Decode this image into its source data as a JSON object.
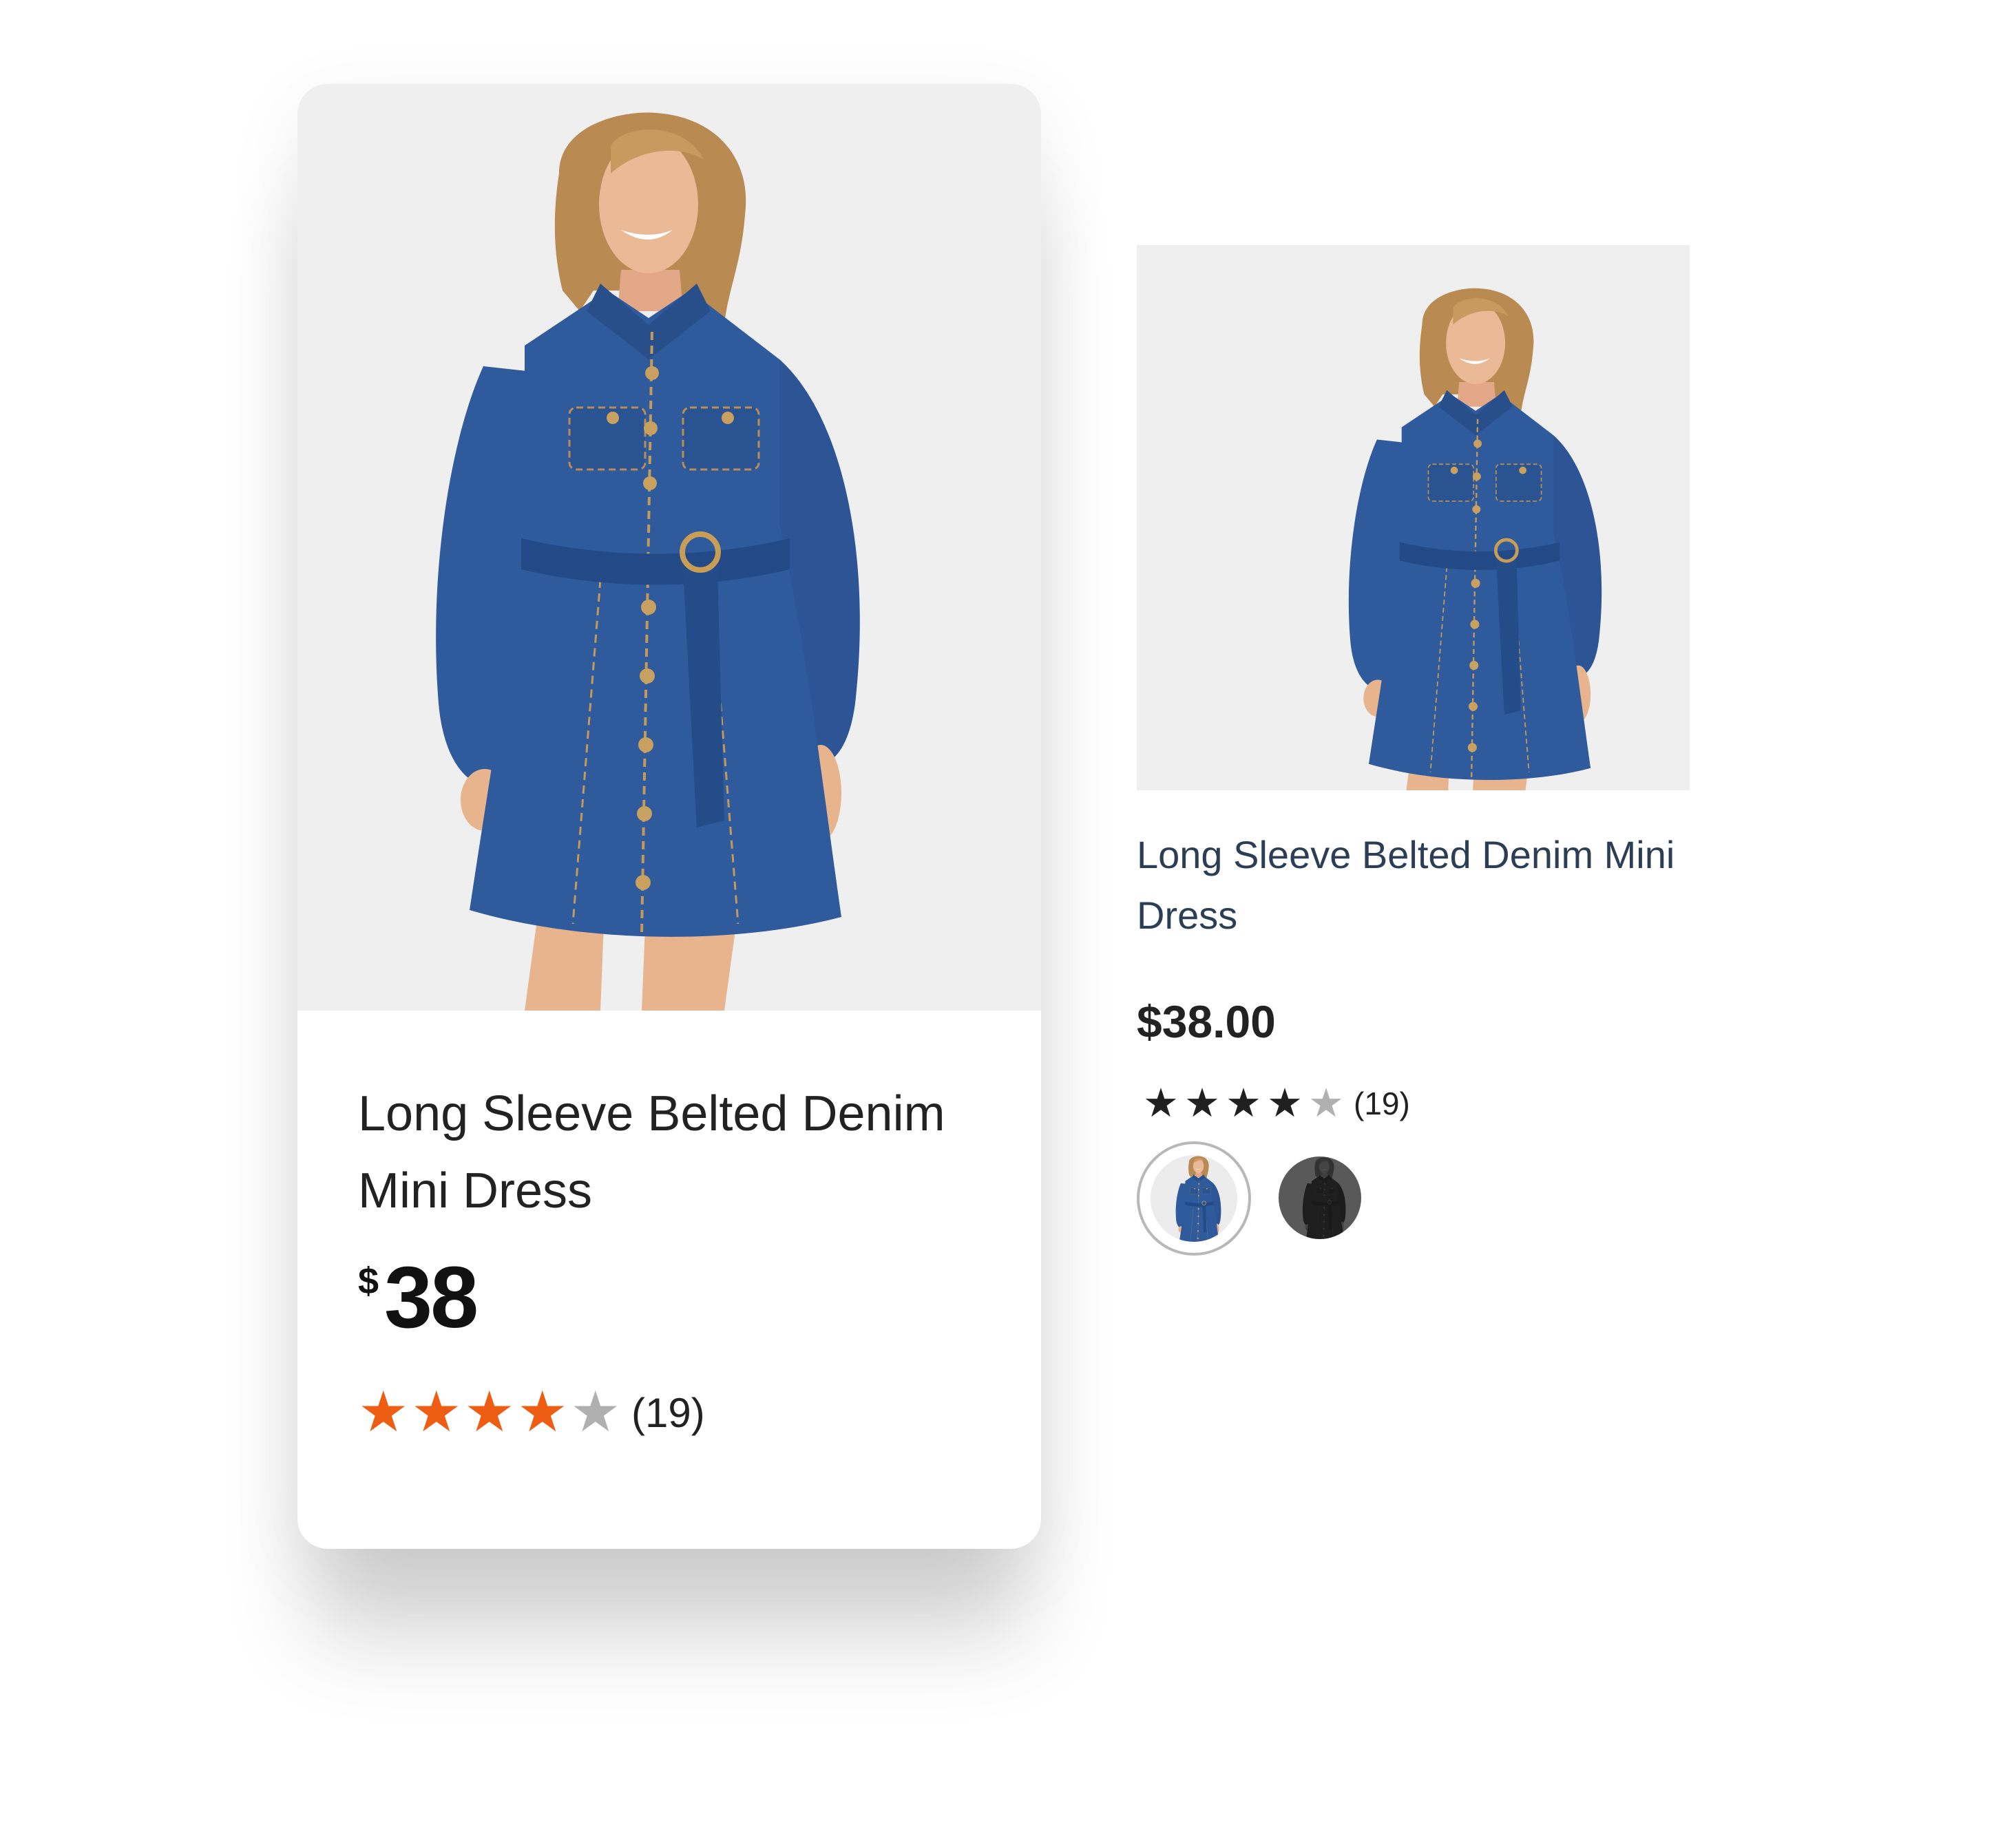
{
  "featured_card": {
    "title": "Long Sleeve Belted Denim Mini Dress",
    "price_currency": "$",
    "price_amount": "38",
    "rating": {
      "value": 4,
      "max": 5,
      "count": "(19)"
    },
    "image_alt": "Woman wearing long sleeve belted denim mini dress"
  },
  "product_tile": {
    "title": "Long Sleeve Belted Denim Mini Dress",
    "price": "$38.00",
    "rating": {
      "value": 4,
      "max": 5,
      "count": "(19)"
    },
    "swatches": [
      {
        "name": "denim-blue",
        "color": "#2f5a9c",
        "selected": true
      },
      {
        "name": "black",
        "color": "#1c1c1e",
        "selected": false
      }
    ]
  },
  "icons": {
    "star_filled": "★",
    "star_empty": "★"
  },
  "colors": {
    "featured_star": "#ee5d14",
    "tile_star": "#202020",
    "empty_star": "#b0b0b0",
    "image_background": "#efefef",
    "tile_title": "#2c3e55"
  }
}
